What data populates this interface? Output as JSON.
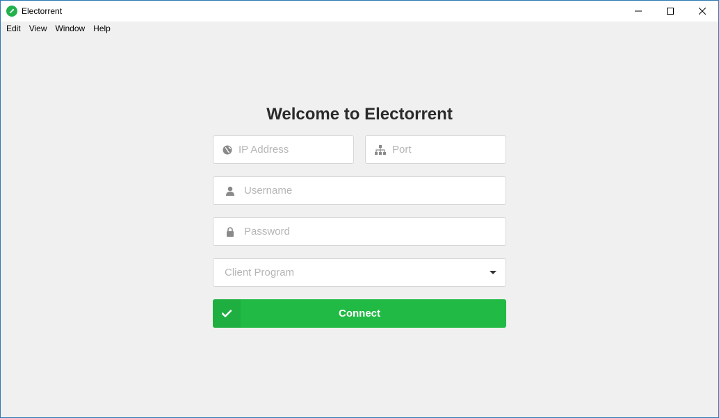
{
  "window": {
    "title": "Electorrent",
    "controls": [
      "minimize-icon",
      "maximize-icon",
      "close-icon"
    ]
  },
  "menubar": {
    "items": [
      {
        "label": "Edit"
      },
      {
        "label": "View"
      },
      {
        "label": "Window"
      },
      {
        "label": "Help"
      }
    ]
  },
  "login": {
    "heading": "Welcome to Electorrent",
    "ip": {
      "placeholder": "IP Address",
      "value": "",
      "icon": "globe-icon"
    },
    "port": {
      "placeholder": "Port",
      "value": "",
      "icon": "sitemap-icon"
    },
    "username": {
      "placeholder": "Username",
      "value": "",
      "icon": "user-icon"
    },
    "password": {
      "placeholder": "Password",
      "value": "",
      "icon": "lock-icon"
    },
    "client": {
      "placeholder": "Client Program",
      "icon": "chevron-down-icon"
    },
    "connect": {
      "label": "Connect",
      "icon": "check-icon"
    }
  },
  "colors": {
    "accent": "#21ba45",
    "frame": "#2b78b5",
    "background": "#f0f0f0"
  }
}
